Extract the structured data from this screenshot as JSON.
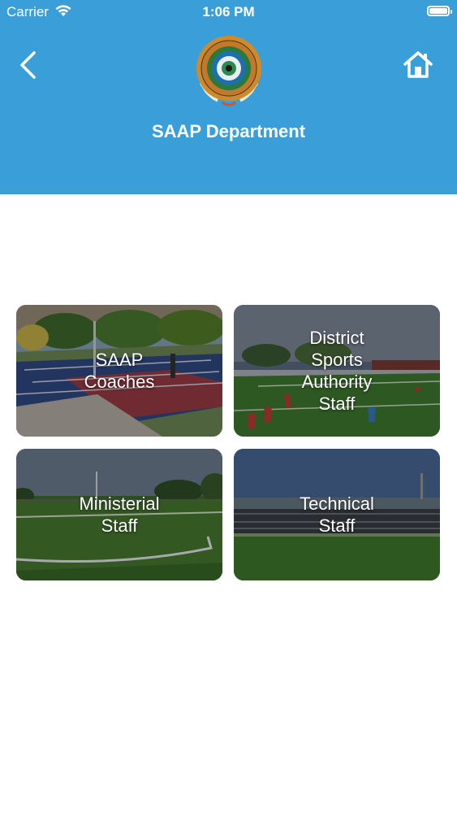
{
  "status_bar": {
    "carrier": "Carrier",
    "time": "1:06 PM"
  },
  "header": {
    "title": "SAAP Department",
    "back_icon": "chevron-left-icon",
    "home_icon": "home-icon",
    "background_color": "#3a9fd8"
  },
  "cards": [
    {
      "label": "SAAP\nCoaches"
    },
    {
      "label": "District\nSports\nAuthority\nStaff"
    },
    {
      "label": "Ministerial\nStaff"
    },
    {
      "label": "Technical\nStaff"
    }
  ]
}
